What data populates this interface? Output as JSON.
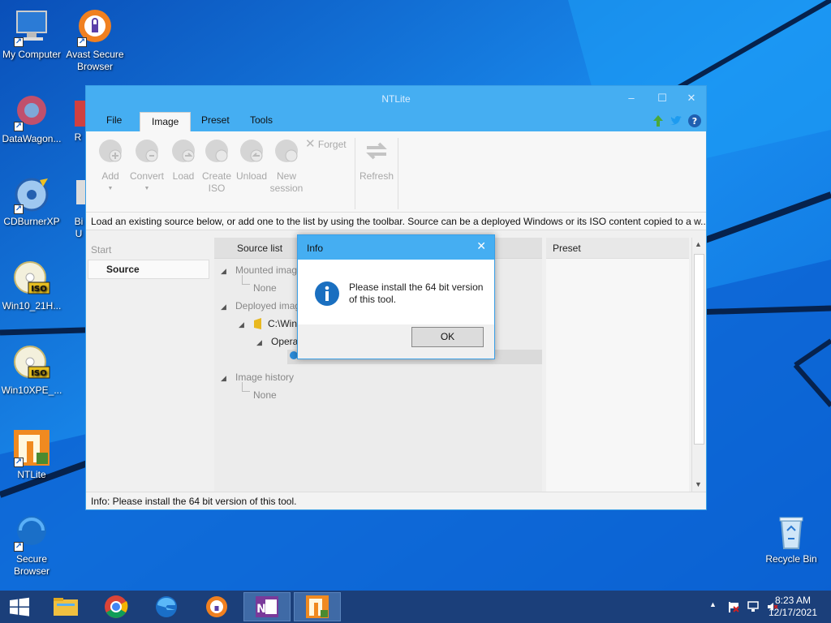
{
  "desktop": {
    "icons": [
      {
        "label": "My Computer"
      },
      {
        "label": "Avast Secure Browser"
      },
      {
        "label": "DataWagon..."
      },
      {
        "label": "R"
      },
      {
        "label": "CDBurnerXP"
      },
      {
        "label": "Bi U"
      },
      {
        "label": "Win10_21H..."
      },
      {
        "label": "Win10XPE_..."
      },
      {
        "label": "NTLite"
      },
      {
        "label": "Secure Browser"
      },
      {
        "label": "Recycle Bin"
      }
    ]
  },
  "window": {
    "title": "NTLite",
    "menu": [
      "File",
      "Image",
      "Preset",
      "Tools"
    ],
    "active_menu": "Image",
    "ribbon": {
      "add": "Add",
      "convert": "Convert",
      "load": "Load",
      "create_iso": "Create ISO",
      "unload": "Unload",
      "new_session": "New session",
      "forget": "Forget",
      "refresh": "Refresh"
    },
    "info_strip": "Load an existing source below, or add one to the list by using the toolbar. Source can be a deployed Windows or its ISO content copied to a w...",
    "nav": {
      "start": "Start",
      "source": "Source"
    },
    "tree": {
      "header": "Source list",
      "mounted": "Mounted imag",
      "mounted_none": "None",
      "deployed": "Deployed imag",
      "path": "C:\\Win",
      "os": "Opera",
      "history": "Image history",
      "history_none": "None"
    },
    "preset_header": "Preset",
    "status": "Info: Please install the 64 bit version of this tool."
  },
  "dialog": {
    "title": "Info",
    "message": "Please install the 64 bit version of this tool.",
    "ok": "OK"
  },
  "clock": {
    "time": "8:23 AM",
    "date": "12/17/2021"
  },
  "colors": {
    "accent": "#45aef2",
    "taskbar": "#1b3f7a",
    "wallpaper": "#0a64d8"
  }
}
